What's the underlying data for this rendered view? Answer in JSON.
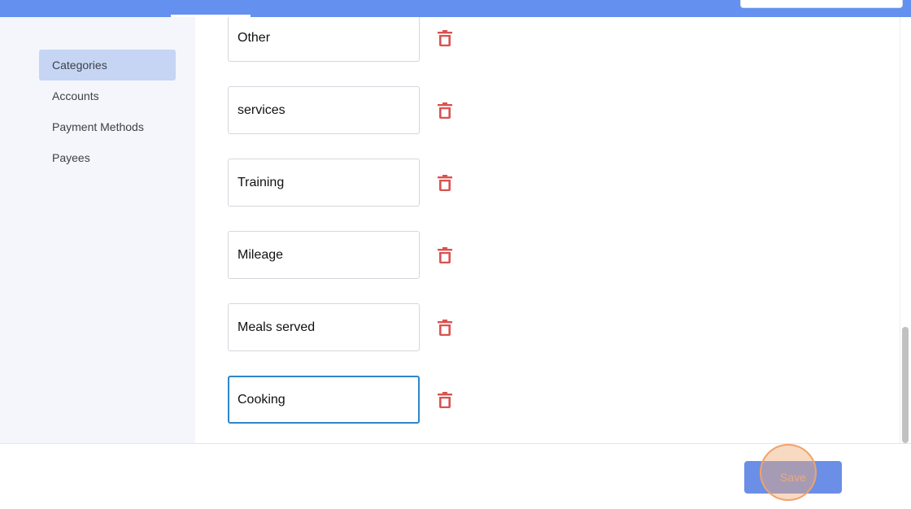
{
  "sidebar": {
    "items": [
      {
        "label": "Categories",
        "active": true
      },
      {
        "label": "Accounts",
        "active": false
      },
      {
        "label": "Payment Methods",
        "active": false
      },
      {
        "label": "Payees",
        "active": false
      }
    ]
  },
  "categories": [
    {
      "value": "Other"
    },
    {
      "value": "services"
    },
    {
      "value": "Training"
    },
    {
      "value": "Mileage"
    },
    {
      "value": "Meals served"
    },
    {
      "value": "Cooking",
      "focused": true
    }
  ],
  "footer": {
    "save_label": "Save"
  },
  "icons": {
    "delete": "trash-icon"
  },
  "colors": {
    "topbar": "#6490ef",
    "active_sidebar": "#c6d5f4",
    "trash": "#d9534f",
    "save_button": "#6b8fe6",
    "focus_border": "#2f86c9"
  }
}
